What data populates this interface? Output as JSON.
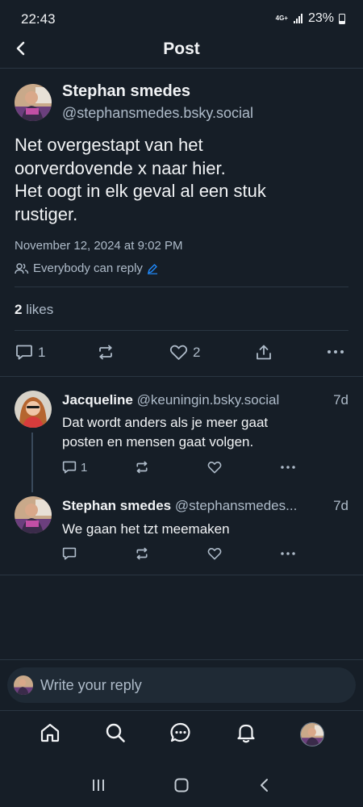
{
  "status_bar": {
    "time": "22:43",
    "network": "4G+",
    "battery": "23%"
  },
  "header": {
    "title": "Post",
    "back_icon": "chevron-left-icon"
  },
  "post": {
    "author_name": "Stephan smedes",
    "author_handle": "@stephansmedes.bsky.social",
    "text_lines": [
      "Net overgestapt van het",
      "oorverdovende x naar hier.",
      "Het oogt in elk geval al een stuk",
      "rustiger."
    ],
    "date": "November 12, 2024 at 9:02 PM",
    "reply_setting": "Everybody can reply",
    "likes_count": "2",
    "likes_label": "likes",
    "reply_count": "1",
    "like_count": "2"
  },
  "replies": [
    {
      "author_name": "Jacqueline",
      "author_handle": "@keuningin.bsky.social",
      "ago": "7d",
      "text_lines": [
        "Dat wordt anders als je meer gaat",
        "posten en mensen gaat volgen."
      ],
      "reply_count": "1"
    },
    {
      "author_name": "Stephan smedes",
      "author_handle": "@stephansmedes...",
      "ago": "7d",
      "text_lines": [
        "We gaan het tzt meemaken"
      ]
    }
  ],
  "composer": {
    "placeholder": "Write your reply"
  },
  "bottom_nav": [
    "home-icon",
    "search-icon",
    "chat-icon",
    "bell-icon",
    "profile-avatar"
  ],
  "colors": {
    "background": "#161e27",
    "accent": "#208bfe",
    "text": "#f1f3f5",
    "muted": "#aebbc9"
  }
}
